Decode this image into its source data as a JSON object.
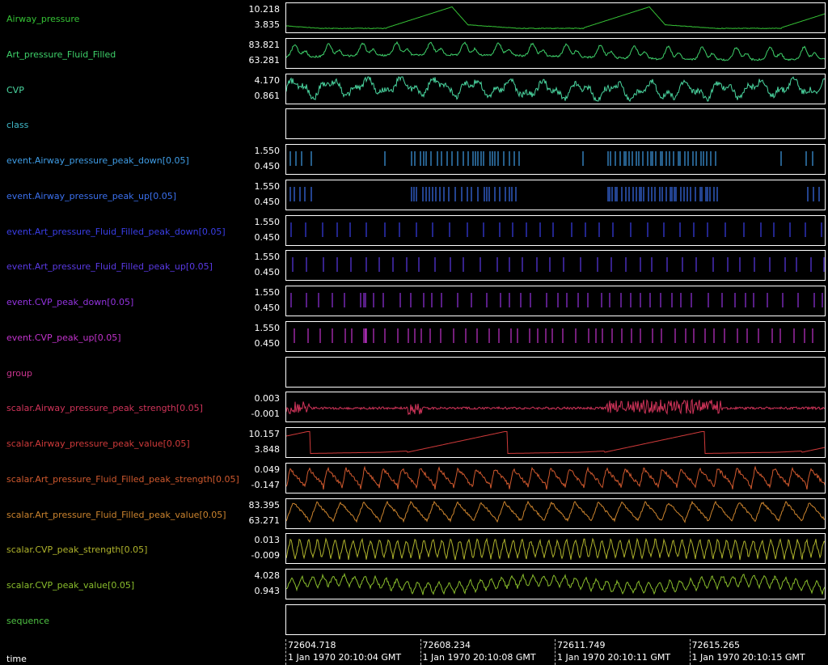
{
  "tracks": [
    {
      "name": "Airway_pressure",
      "color": "#35c235",
      "ymax": "10.218",
      "ymin": "3.835",
      "kind": "wave",
      "pattern": "airway"
    },
    {
      "name": "Art_pressure_Fluid_Filled",
      "color": "#3ed16a",
      "ymax": "83.821",
      "ymin": "63.281",
      "kind": "wave",
      "pattern": "art"
    },
    {
      "name": "CVP",
      "color": "#4ad6a0",
      "ymax": "4.170",
      "ymin": "0.861",
      "kind": "wave",
      "pattern": "cvp"
    },
    {
      "name": "class",
      "color": "#40b8c8",
      "ymax": "",
      "ymin": "",
      "kind": "empty",
      "pattern": ""
    },
    {
      "name": "event.Airway_pressure_peak_down[0.05]",
      "color": "#3f9de6",
      "ymax": "1.550",
      "ymin": "0.450",
      "kind": "events",
      "pattern": "airdown"
    },
    {
      "name": "event.Airway_pressure_peak_up[0.05]",
      "color": "#3b70ee",
      "ymax": "1.550",
      "ymin": "0.450",
      "kind": "events",
      "pattern": "airup"
    },
    {
      "name": "event.Art_pressure_Fluid_Filled_peak_down[0.05]",
      "color": "#3a3ee8",
      "ymax": "1.550",
      "ymin": "0.450",
      "kind": "events",
      "pattern": "regular"
    },
    {
      "name": "event.Art_pressure_Fluid_Filled_peak_up[0.05]",
      "color": "#5a3ae6",
      "ymax": "1.550",
      "ymin": "0.450",
      "kind": "events",
      "pattern": "regular2"
    },
    {
      "name": "event.CVP_peak_down[0.05]",
      "color": "#9433e0",
      "ymax": "1.550",
      "ymin": "0.450",
      "kind": "events",
      "pattern": "cvp"
    },
    {
      "name": "event.CVP_peak_up[0.05]",
      "color": "#c233cc",
      "ymax": "1.550",
      "ymin": "0.450",
      "kind": "events",
      "pattern": "cvp2"
    },
    {
      "name": "group",
      "color": "#c8348e",
      "ymax": "",
      "ymin": "",
      "kind": "empty",
      "pattern": ""
    },
    {
      "name": "scalar.Airway_pressure_peak_strength[0.05]",
      "color": "#d1345a",
      "ymax": "0.003",
      "ymin": "-0.001",
      "kind": "wave",
      "pattern": "airstrength"
    },
    {
      "name": "scalar.Airway_pressure_peak_value[0.05]",
      "color": "#cf3a3a",
      "ymax": "10.157",
      "ymin": "3.848",
      "kind": "wave",
      "pattern": "airvalue"
    },
    {
      "name": "scalar.Art_pressure_Fluid_Filled_peak_strength[0.05]",
      "color": "#d0592e",
      "ymax": "0.049",
      "ymin": "-0.147",
      "kind": "wave",
      "pattern": "artstrength"
    },
    {
      "name": "scalar.Art_pressure_Fluid_Filled_peak_value[0.05]",
      "color": "#cc842e",
      "ymax": "83.395",
      "ymin": "63.271",
      "kind": "wave",
      "pattern": "artvalue"
    },
    {
      "name": "scalar.CVP_peak_strength[0.05]",
      "color": "#b0b42c",
      "ymax": "0.013",
      "ymin": "-0.009",
      "kind": "wave",
      "pattern": "zigzag"
    },
    {
      "name": "scalar.CVP_peak_value[0.05]",
      "color": "#8abe2c",
      "ymax": "4.028",
      "ymin": "0.943",
      "kind": "wave",
      "pattern": "zigzag2"
    },
    {
      "name": "sequence",
      "color": "#4fc243",
      "ymax": "",
      "ymin": "",
      "kind": "empty",
      "pattern": ""
    }
  ],
  "time_axis": {
    "label": "time",
    "ticks": [
      {
        "value": "72604.718",
        "date": "1 Jan 1970 20:10:04 GMT"
      },
      {
        "value": "72608.234",
        "date": "1 Jan 1970 20:10:08 GMT"
      },
      {
        "value": "72611.749",
        "date": "1 Jan 1970 20:10:11 GMT"
      },
      {
        "value": "72615.265",
        "date": "1 Jan 1970 20:10:15 GMT"
      }
    ]
  }
}
